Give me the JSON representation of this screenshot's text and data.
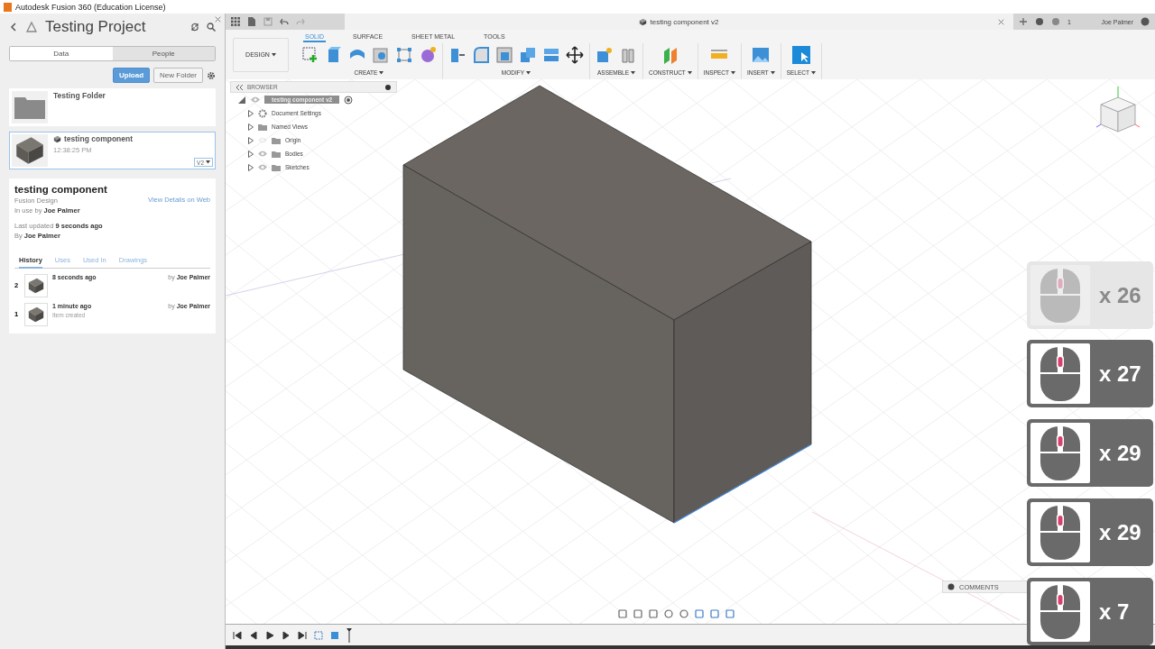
{
  "app_title": "Autodesk Fusion 360 (Education License)",
  "data_panel": {
    "project": "Testing Project",
    "tabs": [
      {
        "label": "Data",
        "selected": true
      },
      {
        "label": "People",
        "selected": false
      }
    ],
    "buttons": [
      {
        "label": "Upload",
        "kind": "primary"
      },
      {
        "label": "New Folder",
        "kind": "secondary"
      }
    ],
    "items": [
      {
        "kind": "folder",
        "name": "Testing Folder",
        "selected": false
      },
      {
        "kind": "design",
        "name": "testing component",
        "time": "12:38:25 PM",
        "version": "V2",
        "selected": true
      }
    ]
  },
  "details": {
    "title": "testing component",
    "type": "Fusion Design",
    "in_use": "In use by **Joe Palmer**",
    "link": "View Details on Web",
    "updated": "Last updated **9 seconds ago**",
    "by": "By **Joe Palmer**",
    "tabs": [
      {
        "label": "History",
        "selected": true
      },
      {
        "label": "Uses",
        "selected": false
      },
      {
        "label": "Used In",
        "selected": false
      },
      {
        "label": "Drawings",
        "selected": false
      }
    ],
    "history": [
      {
        "version": "2",
        "when": "8 seconds ago",
        "by": "by **Joe Palmer**"
      },
      {
        "version": "1",
        "when": "1 minute ago",
        "note": "Item created",
        "by": "by **Joe Palmer**"
      }
    ]
  },
  "document_tab": {
    "title": "testing component v2"
  },
  "account": {
    "jobs": "1",
    "user": "Joe Palmer"
  },
  "workspace": "DESIGN",
  "ribbon_tabs": [
    {
      "label": "SOLID",
      "selected": true
    },
    {
      "label": "SURFACE",
      "selected": false
    },
    {
      "label": "SHEET METAL",
      "selected": false
    },
    {
      "label": "TOOLS",
      "selected": false
    }
  ],
  "ribbon_groups": [
    {
      "label": "CREATE"
    },
    {
      "label": "MODIFY"
    },
    {
      "label": "ASSEMBLE"
    },
    {
      "label": "CONSTRUCT"
    },
    {
      "label": "INSPECT"
    },
    {
      "label": "INSERT"
    },
    {
      "label": "SELECT"
    }
  ],
  "browser": {
    "title": "BROWSER",
    "root": "testing component v2",
    "items": [
      {
        "label": "Document Settings",
        "kind": "settings"
      },
      {
        "label": "Named Views",
        "kind": "folder"
      },
      {
        "label": "Origin",
        "kind": "folder",
        "visible": false
      },
      {
        "label": "Bodies",
        "kind": "folder",
        "visible": true
      },
      {
        "label": "Sketches",
        "kind": "folder",
        "visible": true
      }
    ]
  },
  "comments": "COMMENTS",
  "mouse_counter": [
    {
      "count": "x 26",
      "faded": true
    },
    {
      "count": "x 27",
      "faded": false
    },
    {
      "count": "x 29",
      "faded": false
    },
    {
      "count": "x 29",
      "faded": false
    },
    {
      "count": "x 7",
      "faded": false
    }
  ]
}
